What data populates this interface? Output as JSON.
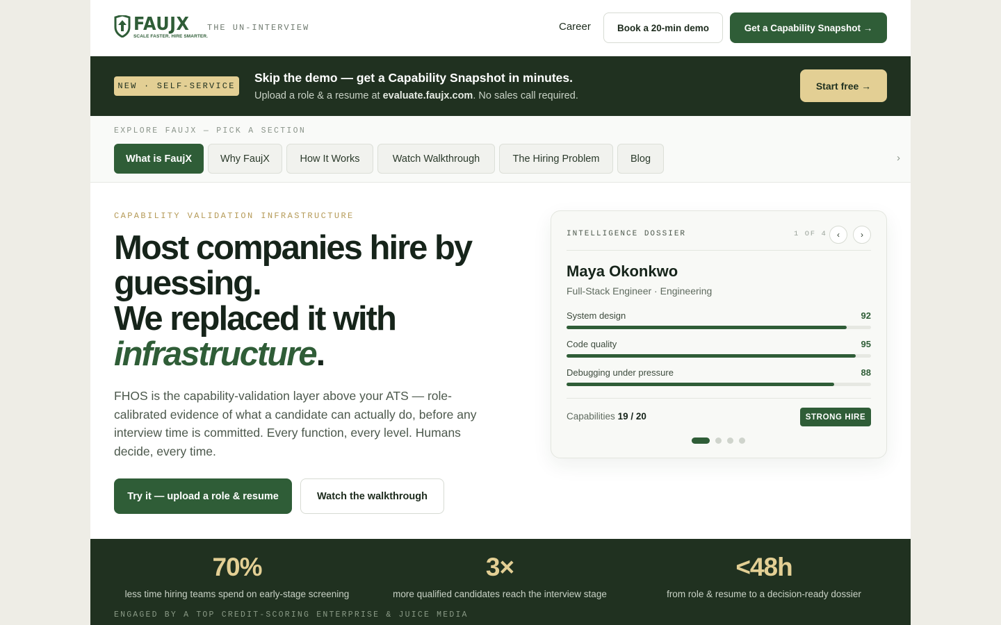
{
  "header": {
    "logo_word": "FAUJX",
    "logo_tagline": "SCALE FASTER. HIRE SMARTER.",
    "tagline": "THE UN-INTERVIEW",
    "career_link": "Career",
    "demo_button": "Book a 20-min demo",
    "snapshot_button": "Get a Capability Snapshot →"
  },
  "promo": {
    "badge": "NEW · SELF-SERVICE",
    "title": "Skip the demo — get a Capability Snapshot in minutes.",
    "sub_before": "Upload a role & a resume at ",
    "sub_url": "evaluate.faujx.com",
    "sub_after": ". No sales call required.",
    "cta": "Start free →"
  },
  "section_nav": {
    "label": "EXPLORE FAUJX — PICK A SECTION",
    "tabs": [
      {
        "label": "What is FaujX"
      },
      {
        "label": "Why FaujX"
      },
      {
        "label": "How It Works"
      },
      {
        "label": "Watch Walkthrough"
      },
      {
        "label": "The Hiring Problem"
      },
      {
        "label": "Blog"
      }
    ],
    "active_tab": "What is FaujX",
    "scroll_arrow": "›"
  },
  "hero": {
    "eyebrow": "CAPABILITY VALIDATION INFRASTRUCTURE",
    "title_line1": "Most companies hire by",
    "title_line2": "guessing.",
    "title_line3": "We replaced it with",
    "title_emphasis": "infrastructure",
    "title_period": ".",
    "body": "FHOS is the capability-validation layer above your ATS — role-calibrated evidence of what a candidate can actually do, before any interview time is committed. Every function, every level. Humans decide, every time.",
    "primary_cta": "Try it — upload a role & resume",
    "secondary_cta": "Watch the walkthrough"
  },
  "dossier": {
    "kicker": "INTELLIGENCE DOSSIER",
    "counter": "1 OF 4",
    "prev_icon": "‹",
    "next_icon": "›",
    "name": "Maya Okonkwo",
    "role": "Full-Stack Engineer · Engineering",
    "skills": [
      {
        "name": "System design",
        "score": "92"
      },
      {
        "name": "Code quality",
        "score": "95"
      },
      {
        "name": "Debugging under pressure",
        "score": "88"
      }
    ],
    "capabilities_label": "Capabilities",
    "capabilities_value": "19 / 20",
    "verdict": "STRONG HIRE",
    "slides_total": 4,
    "active_slide": 1
  },
  "stats": {
    "items": [
      {
        "value": "70%",
        "label": "less time hiring teams spend on early-stage screening"
      },
      {
        "value": "3×",
        "label": "more qualified candidates reach the interview stage"
      },
      {
        "value": "<48h",
        "label": "from role & resume to a decision-ready dossier"
      }
    ],
    "footer": "ENGAGED BY A TOP CREDIT-SCORING ENTERPRISE & JUICE MEDIA"
  },
  "colors": {
    "brand_green": "#2f5d37",
    "dark_band": "#203120",
    "gold": "#e3cf94",
    "page_bg": "#eeede6"
  }
}
